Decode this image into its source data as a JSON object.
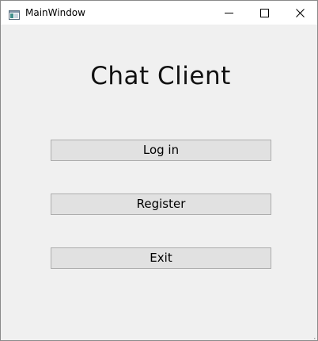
{
  "window": {
    "title": "MainWindow",
    "icon": "app-window-icon",
    "controls": {
      "minimize": "minimize-icon",
      "maximize": "maximize-icon",
      "close": "close-icon"
    }
  },
  "main": {
    "heading": "Chat Client",
    "buttons": {
      "login": "Log in",
      "register": "Register",
      "exit": "Exit"
    }
  },
  "colors": {
    "client_background": "#f0f0f0",
    "button_face": "#e1e1e1",
    "button_border": "#adadad"
  }
}
